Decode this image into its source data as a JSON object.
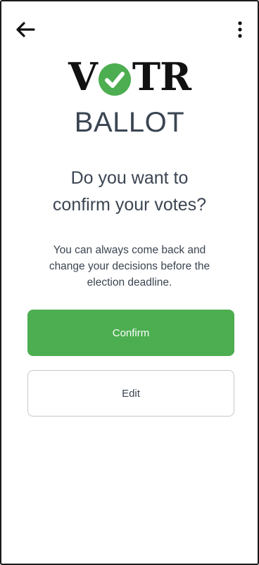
{
  "header": {
    "back_icon": "arrow-left-icon",
    "menu_icon": "more-vertical-icon"
  },
  "logo": {
    "part1": "V",
    "check_icon": "check-circle-icon",
    "part2": "TR",
    "check_color": "#4cae50"
  },
  "page": {
    "subtitle": "BALLOT",
    "question_line1": "Do you want to",
    "question_line2": "confirm your votes?",
    "info_line1": "You can always come back and",
    "info_line2": "change your decisions before the",
    "info_line3": "election deadline."
  },
  "buttons": {
    "confirm_label": "Confirm",
    "edit_label": "Edit"
  },
  "colors": {
    "accent": "#4cae50",
    "text": "#3b4552"
  }
}
